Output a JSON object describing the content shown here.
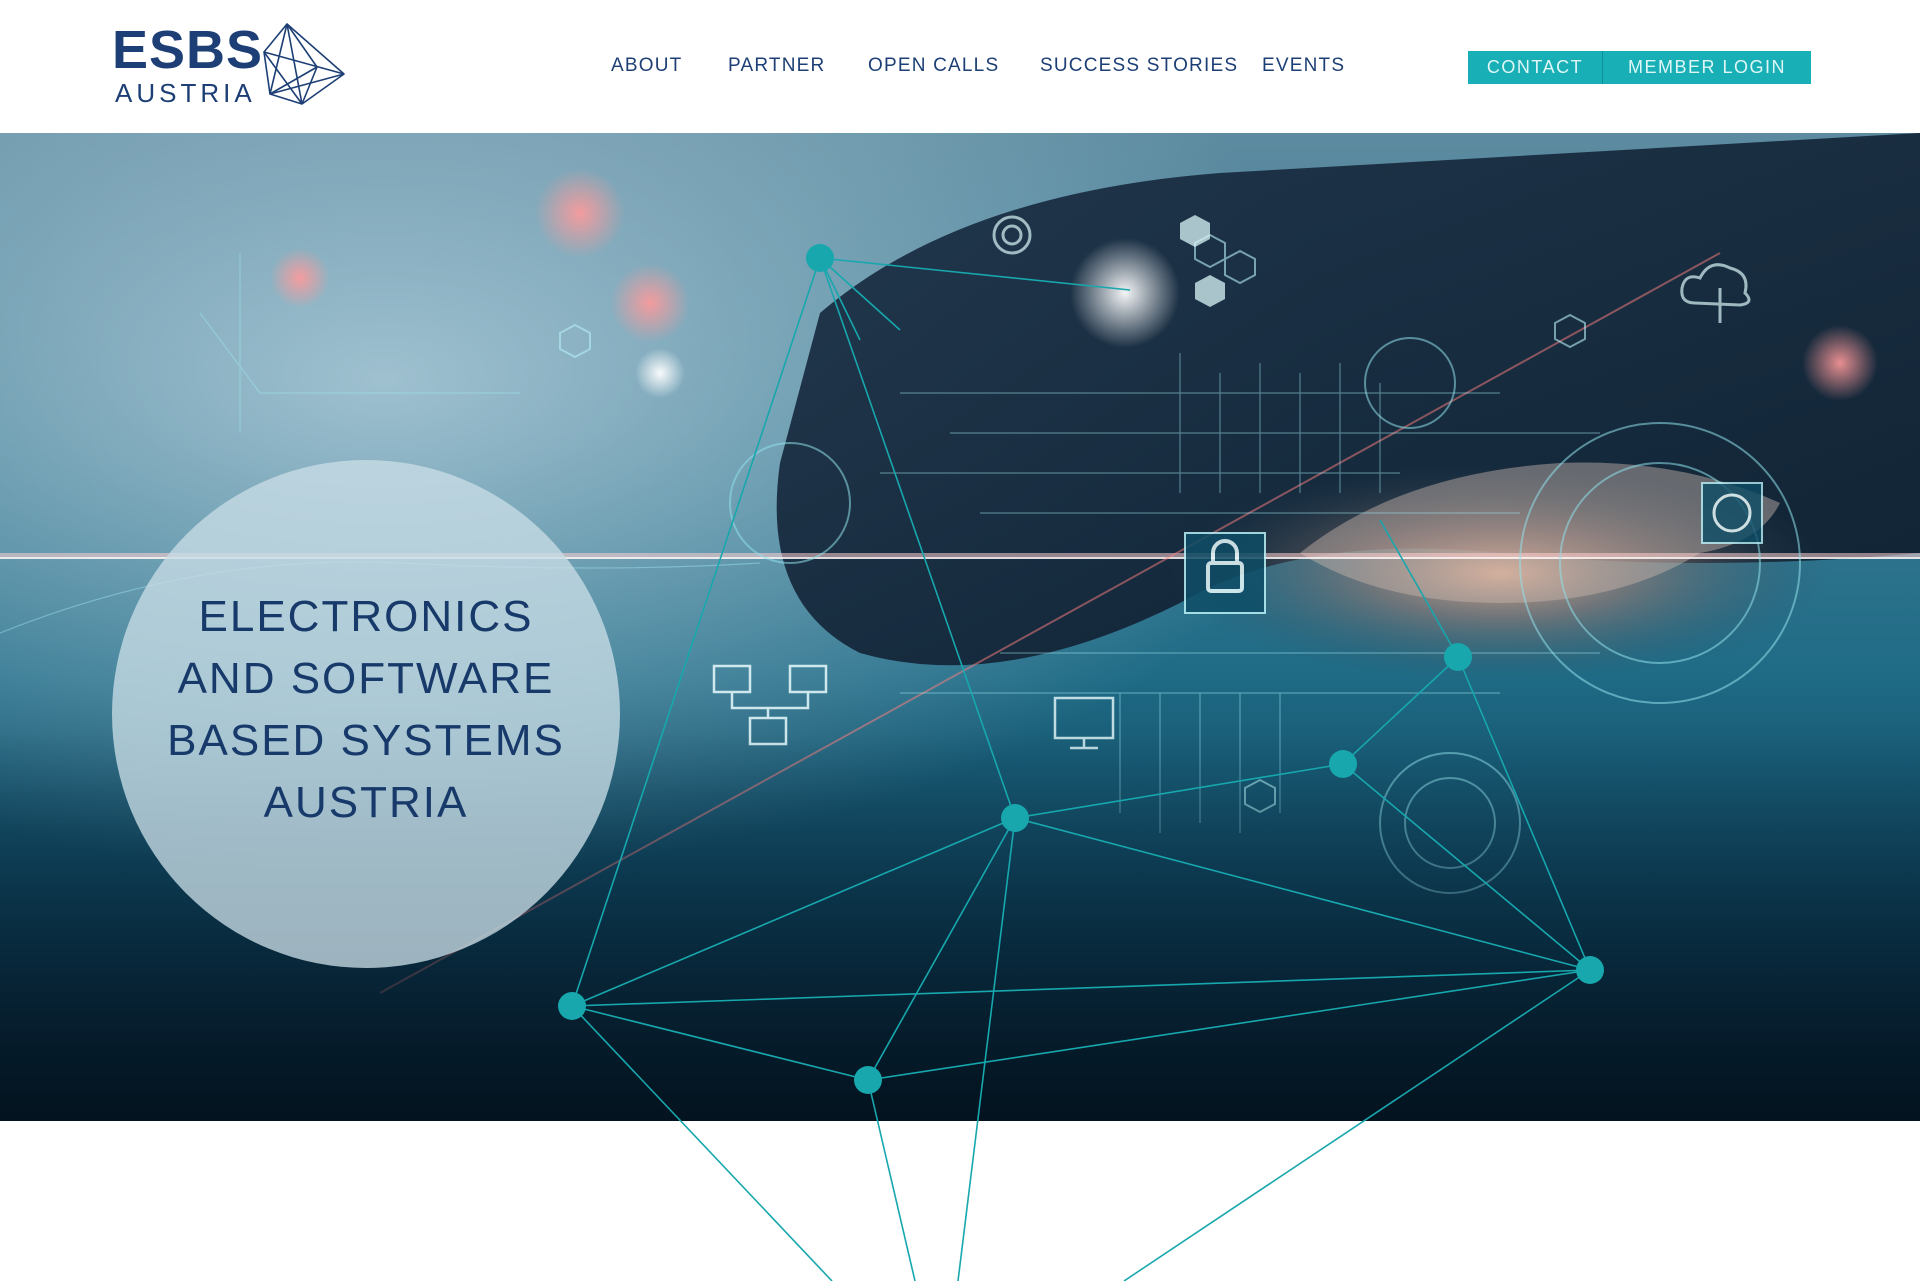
{
  "brand": {
    "name": "ESBS",
    "subname": "AUSTRIA"
  },
  "nav": {
    "items": [
      {
        "label": "ABOUT"
      },
      {
        "label": "PARTNER"
      },
      {
        "label": "OPEN CALLS"
      },
      {
        "label": "SUCCESS STORIES"
      },
      {
        "label": "EVENTS"
      }
    ],
    "contact_label": "CONTACT",
    "login_label": "MEMBER LOGIN"
  },
  "hero": {
    "title_lines": [
      "ELECTRONICS",
      "AND SOFTWARE",
      "BASED SYSTEMS",
      "AUSTRIA"
    ]
  },
  "colors": {
    "brand_blue": "#1d3f75",
    "accent_teal": "#18b0b6",
    "node_teal": "#17a7ad"
  },
  "icons": [
    "logo-mark-icon",
    "lock-icon",
    "monitor-icon",
    "cloud-icon",
    "brain-icon",
    "hexagon-icon",
    "target-icon",
    "network-icon"
  ]
}
